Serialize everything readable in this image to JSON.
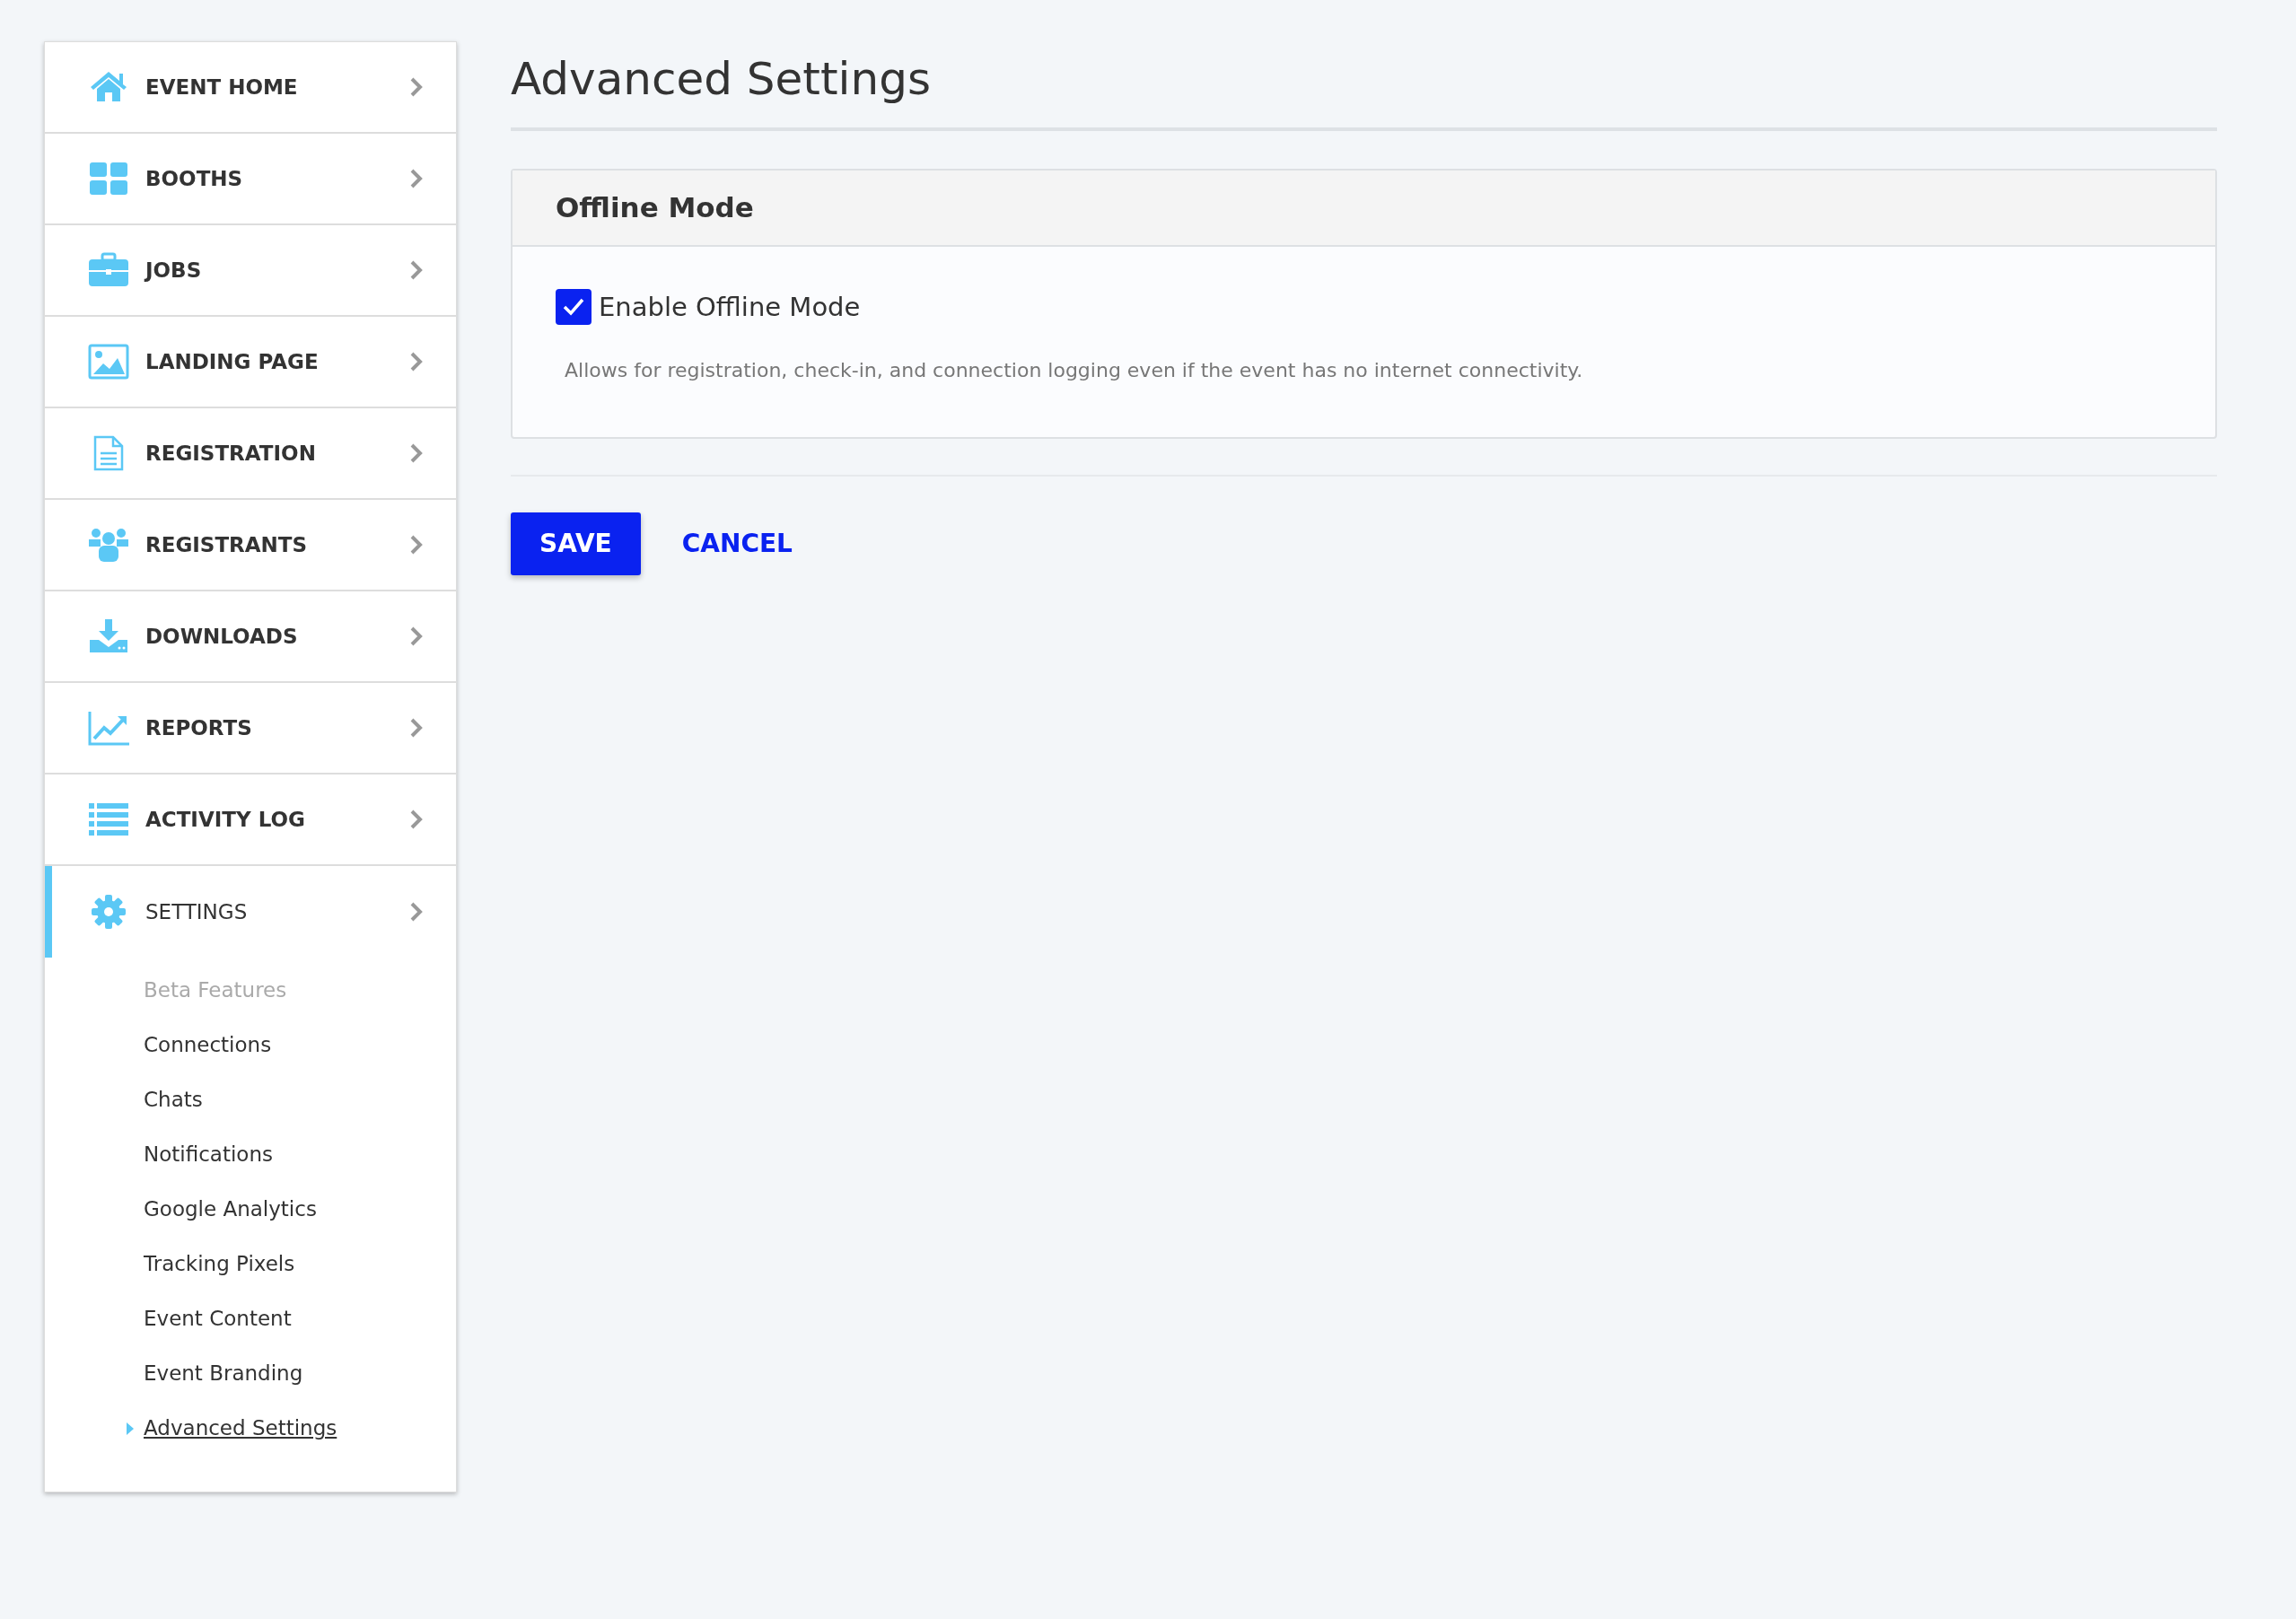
{
  "sidebar": {
    "items": [
      {
        "label": "EVENT HOME",
        "selected": false
      },
      {
        "label": "BOOTHS",
        "selected": false
      },
      {
        "label": "JOBS",
        "selected": false
      },
      {
        "label": "LANDING PAGE",
        "selected": false
      },
      {
        "label": "REGISTRATION",
        "selected": false
      },
      {
        "label": "REGISTRANTS",
        "selected": false
      },
      {
        "label": "DOWNLOADS",
        "selected": false
      },
      {
        "label": "REPORTS",
        "selected": false
      },
      {
        "label": "ACTIVITY LOG",
        "selected": false
      },
      {
        "label": "SETTINGS",
        "selected": true,
        "children": [
          {
            "label": "Beta Features",
            "selected": false,
            "disabled": true
          },
          {
            "label": "Connections",
            "selected": false,
            "disabled": false
          },
          {
            "label": "Chats",
            "selected": false,
            "disabled": false
          },
          {
            "label": "Notifications",
            "selected": false,
            "disabled": false
          },
          {
            "label": "Google Analytics",
            "selected": false,
            "disabled": false
          },
          {
            "label": "Tracking Pixels",
            "selected": false,
            "disabled": false
          },
          {
            "label": "Event Content",
            "selected": false,
            "disabled": false
          },
          {
            "label": "Event Branding",
            "selected": false,
            "disabled": false
          },
          {
            "label": "Advanced Settings",
            "selected": true,
            "disabled": false
          }
        ]
      }
    ]
  },
  "page_title": "Advanced Settings",
  "panel": {
    "title": "Offline Mode",
    "option": {
      "label": "Enable Offline Mode",
      "checked": true
    },
    "description": "Allows for registration, check-in, and connection logging even if the event has no internet connectivity."
  },
  "buttons": [
    "SAVE",
    "CANCEL"
  ]
}
